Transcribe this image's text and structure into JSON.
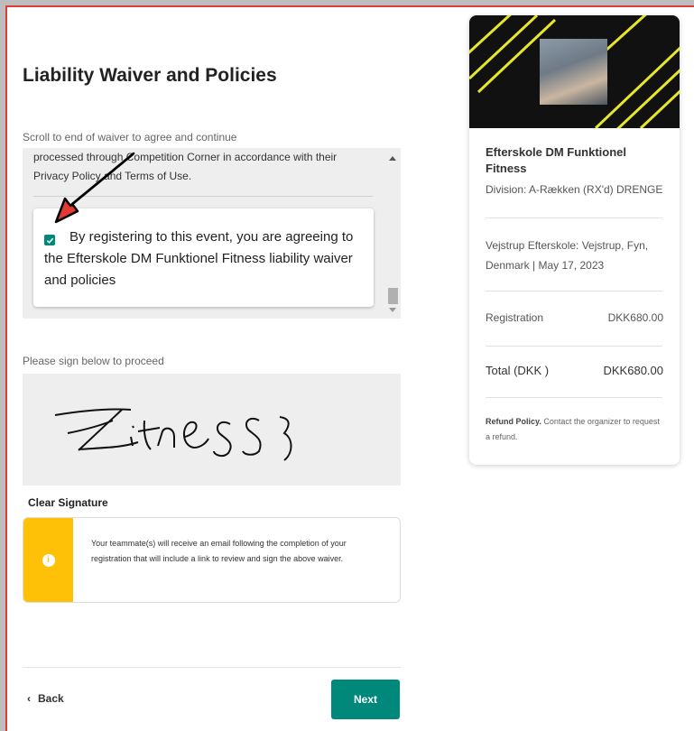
{
  "page": {
    "title": "Liability Waiver and Policies",
    "scroll_hint": "Scroll to end of waiver to agree and continue"
  },
  "waiver": {
    "partial_text": "processed through Competition Corner in accordance with their Privacy Policy and Terms of Use.",
    "agreement_text": "By registering to this event, you are agreeing to the Efterskole DM Funktionel Fitness liability waiver and policies",
    "agreement_checked": true
  },
  "signature": {
    "label": "Please sign below to proceed",
    "signed_text": "Fitness",
    "clear_label": "Clear Signature"
  },
  "info": {
    "text": "Your teammate(s) will receive an email following the completion of your registration that will include a link to review and sign the above waiver."
  },
  "footer": {
    "back_label": "Back",
    "next_label": "Next"
  },
  "event": {
    "name": "Efterskole DM Funktionel Fitness",
    "division": "Division: A-Rækken (RX'd) DRENGE",
    "location": "Vejstrup Efterskole: Vejstrup, Fyn, Denmark | May 17, 2023",
    "registration_label": "Registration",
    "registration_value": "DKK680.00",
    "total_label": "Total (DKK )",
    "total_value": "DKK680.00",
    "refund_title": "Refund Policy.",
    "refund_text": "Contact the organizer to request a refund."
  },
  "colors": {
    "accent": "#00897b",
    "info_strip": "#ffc107",
    "annotation_arrow": "#e53935",
    "banner_stripes": "#e6e62a"
  }
}
